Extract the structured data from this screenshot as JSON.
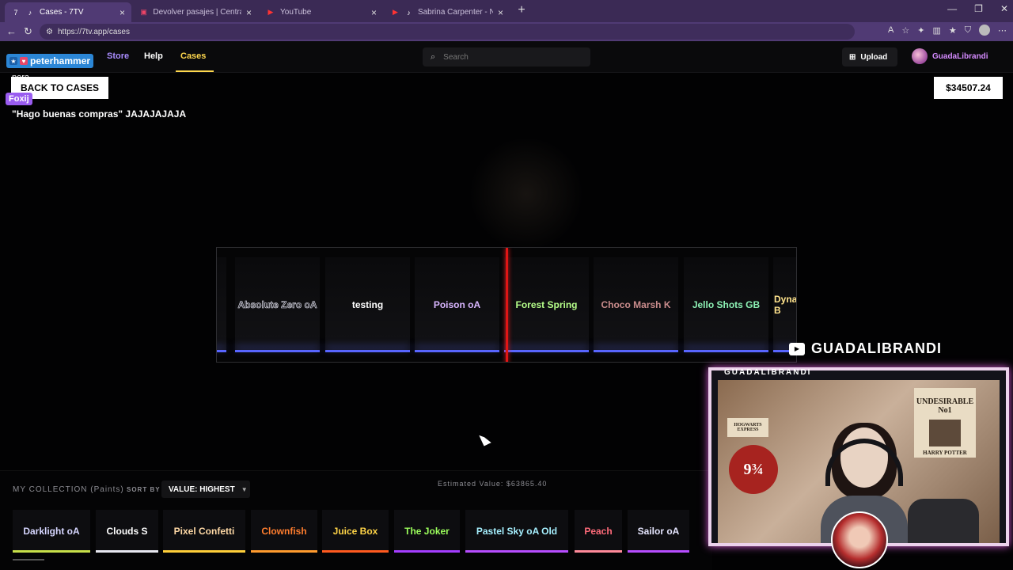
{
  "browser": {
    "tabs": [
      {
        "title": "Cases - 7TV",
        "icon": "7tv-icon",
        "active": true
      },
      {
        "title": "Devolver pasajes | Central de Pasa",
        "icon": "bus-site-icon",
        "active": false
      },
      {
        "title": "YouTube",
        "icon": "youtube-icon",
        "active": false
      },
      {
        "title": "Sabrina Carpenter - Never Ge",
        "icon": "youtube-icon",
        "active": false
      }
    ],
    "url": "https://7tv.app/cases"
  },
  "header": {
    "nav": {
      "store": "Store",
      "help": "Help",
      "cases": "Cases"
    },
    "search_placeholder": "Search",
    "upload_label": "Upload",
    "username": "GuadaLibrandi"
  },
  "chat": {
    "username": "peterhammer",
    "line2": "pera",
    "user2": "Foxij",
    "message": "\"Hago buenas compras\" JAJAJAJAJA"
  },
  "page": {
    "back_label": "BACK TO CASES",
    "balance": "$34507.24"
  },
  "roller": {
    "items": [
      {
        "label": "Absolute Zero oA",
        "color": "#e6e6f0"
      },
      {
        "label": "testing",
        "color": "#ffffff"
      },
      {
        "label": "Poison oA",
        "color": "#d9b6ff"
      },
      {
        "label": "Forest Spring",
        "color": "#b6ff8a"
      },
      {
        "label": "Choco Marsh K",
        "color": "#c98c8c"
      },
      {
        "label": "Jello Shots GB",
        "color": "#8cf0b4"
      },
      {
        "label": "Dyna B",
        "color": "#ffe38c"
      }
    ]
  },
  "collection": {
    "title": "MY COLLECTION (Paints)",
    "sort_label": "SORT BY",
    "sort_value": "VALUE: HIGHEST",
    "estimated": "Estimated Value: $63865.40",
    "paints": [
      {
        "label": "Darklight oA",
        "color": "#d6d6ff",
        "underline": "#c7e04a"
      },
      {
        "label": "Clouds S",
        "color": "#ffffff",
        "underline": "#e8e8f0"
      },
      {
        "label": "Pixel Confetti",
        "color": "#ffd9a6",
        "underline": "#ffcf3a"
      },
      {
        "label": "Clownfish",
        "color": "#ff7d2e",
        "underline": "#ff9b2e"
      },
      {
        "label": "Juice Box",
        "color": "#ffd447",
        "underline": "#ff5a1f"
      },
      {
        "label": "The Joker",
        "color": "#9cff5c",
        "underline": "#a43dff"
      },
      {
        "label": "Pastel Sky oA Old",
        "color": "#a6f0ff",
        "underline": "#b74dff"
      },
      {
        "label": "Peach",
        "color": "#ff6b7a",
        "underline": "#ff8a9a"
      },
      {
        "label": "Sailor oA",
        "color": "#e6e6ff",
        "underline": "#b74dff"
      }
    ]
  },
  "overlay": {
    "channel": "GUADALIBRANDI",
    "cam_label": "GUADALIBRANDI",
    "poster1": "UNDESIRABLE No1",
    "poster1_sub": "HARRY POTTER",
    "poster2": "HOGWARTS EXPRESS",
    "platform": "9¾"
  }
}
